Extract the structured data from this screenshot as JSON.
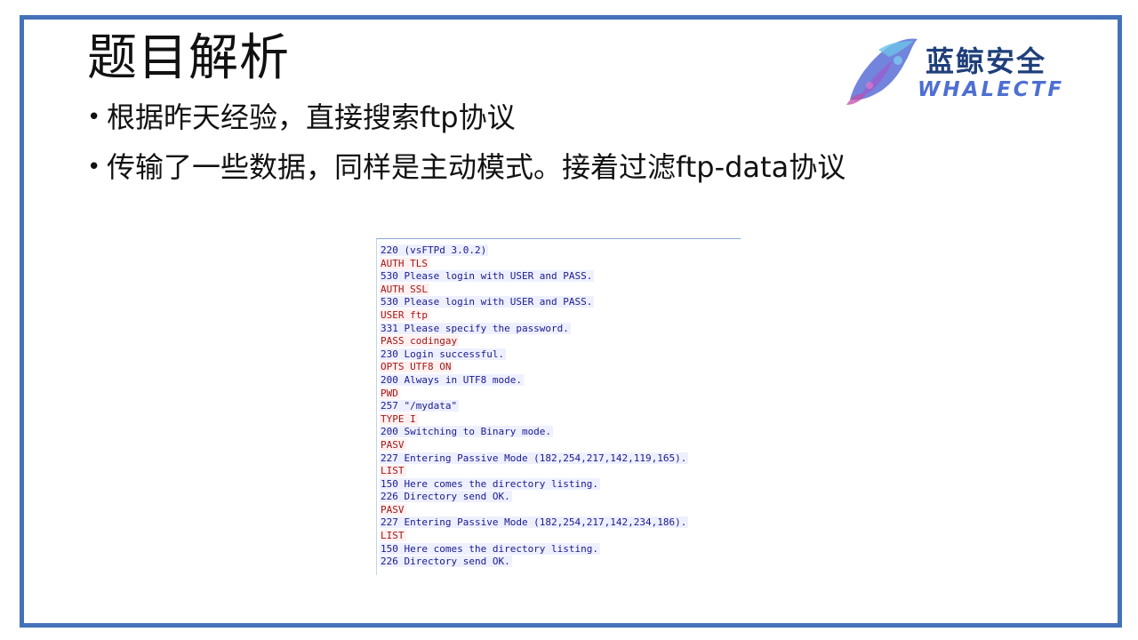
{
  "slide": {
    "title": "题目解析",
    "bullets": [
      "根据昨天经验，直接搜索ftp协议",
      "传输了一些数据，同样是主动模式。接着过滤ftp-data协议"
    ],
    "bullet_char": "•"
  },
  "logo": {
    "cn": "蓝鲸安全",
    "en": "WHALECTF"
  },
  "ftp_stream": [
    {
      "from": "server",
      "text": "220 (vsFTPd 3.0.2)"
    },
    {
      "from": "client",
      "text": "AUTH TLS"
    },
    {
      "from": "server",
      "text": "530 Please login with USER and PASS."
    },
    {
      "from": "client",
      "text": "AUTH SSL"
    },
    {
      "from": "server",
      "text": "530 Please login with USER and PASS."
    },
    {
      "from": "client",
      "text": "USER ftp"
    },
    {
      "from": "server",
      "text": "331 Please specify the password."
    },
    {
      "from": "client",
      "text": "PASS codingay"
    },
    {
      "from": "server",
      "text": "230 Login successful."
    },
    {
      "from": "client",
      "text": "OPTS UTF8 ON"
    },
    {
      "from": "server",
      "text": "200 Always in UTF8 mode."
    },
    {
      "from": "client",
      "text": "PWD"
    },
    {
      "from": "server",
      "text": "257 \"/mydata\""
    },
    {
      "from": "client",
      "text": "TYPE I"
    },
    {
      "from": "server",
      "text": "200 Switching to Binary mode."
    },
    {
      "from": "client",
      "text": "PASV"
    },
    {
      "from": "server",
      "text": "227 Entering Passive Mode (182,254,217,142,119,165)."
    },
    {
      "from": "client",
      "text": "LIST"
    },
    {
      "from": "server",
      "text": "150 Here comes the directory listing."
    },
    {
      "from": "server",
      "text": "226 Directory send OK."
    },
    {
      "from": "client",
      "text": "PASV"
    },
    {
      "from": "server",
      "text": "227 Entering Passive Mode (182,254,217,142,234,186)."
    },
    {
      "from": "client",
      "text": "LIST"
    },
    {
      "from": "server",
      "text": "150 Here comes the directory listing."
    },
    {
      "from": "server",
      "text": "226 Directory send OK."
    }
  ],
  "colors": {
    "frame": "#4472b8",
    "server_text": "#1a1a8c",
    "client_text": "#a01818",
    "logo_cn": "#1f3f7a",
    "logo_en": "#4e6fd2"
  }
}
